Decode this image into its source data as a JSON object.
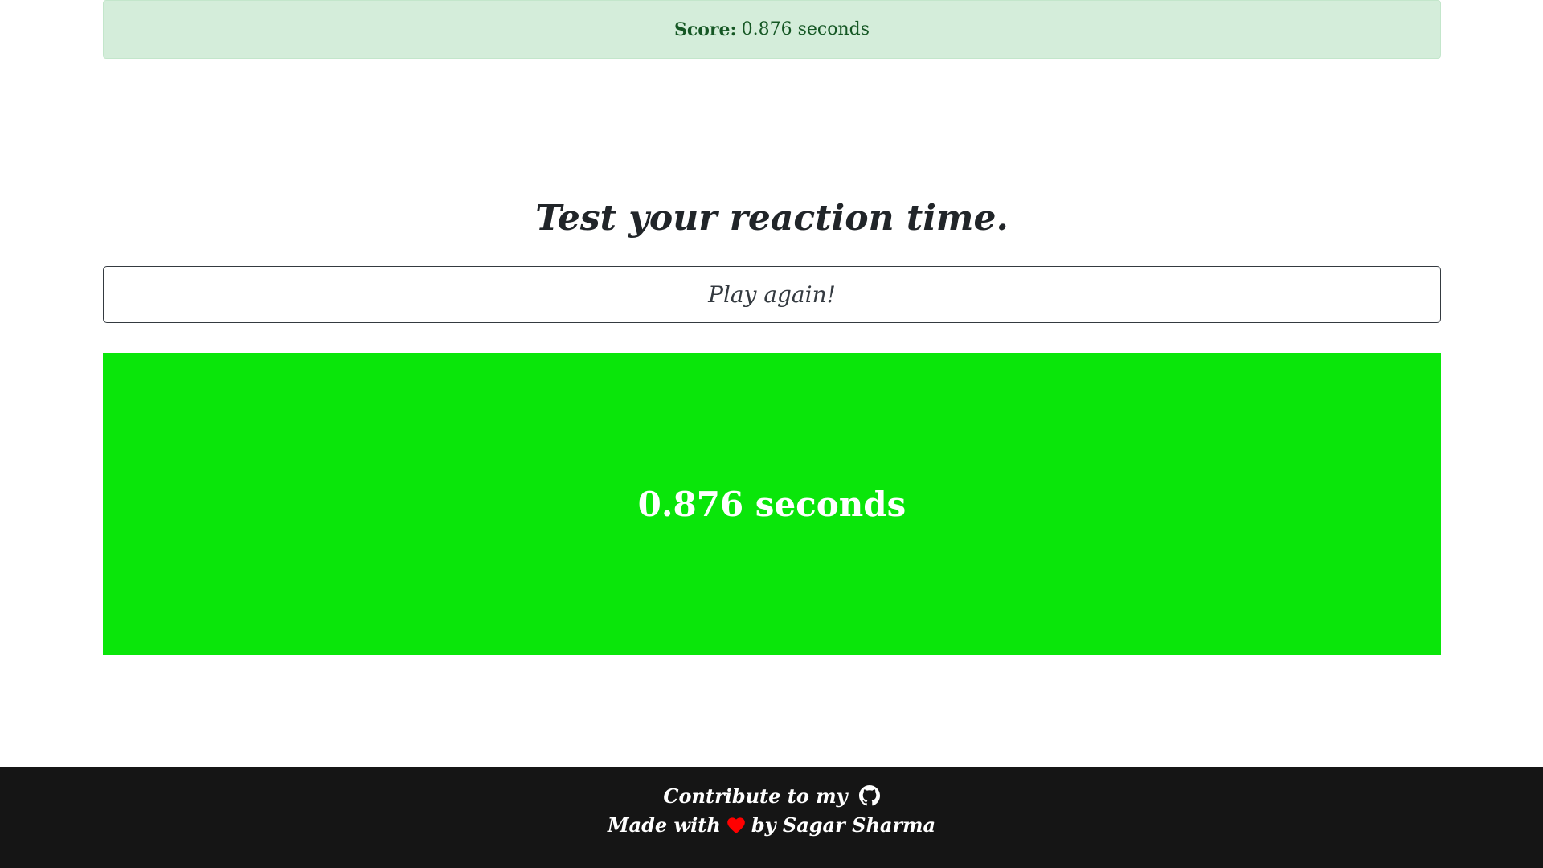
{
  "score": {
    "label": "Score:",
    "value": "0.876 seconds",
    "accent_color": "#d4edda"
  },
  "heading": "Test your reaction time.",
  "play_button_label": "Play again!",
  "reaction_box": {
    "text": "0.876 seconds",
    "color": "#0ae60a"
  },
  "footer": {
    "contribute_text": "Contribute to my",
    "github_icon": "github-icon",
    "made_with_text": "Made with",
    "heart_icon": "heart-icon",
    "by_text": "by Sagar Sharma"
  }
}
